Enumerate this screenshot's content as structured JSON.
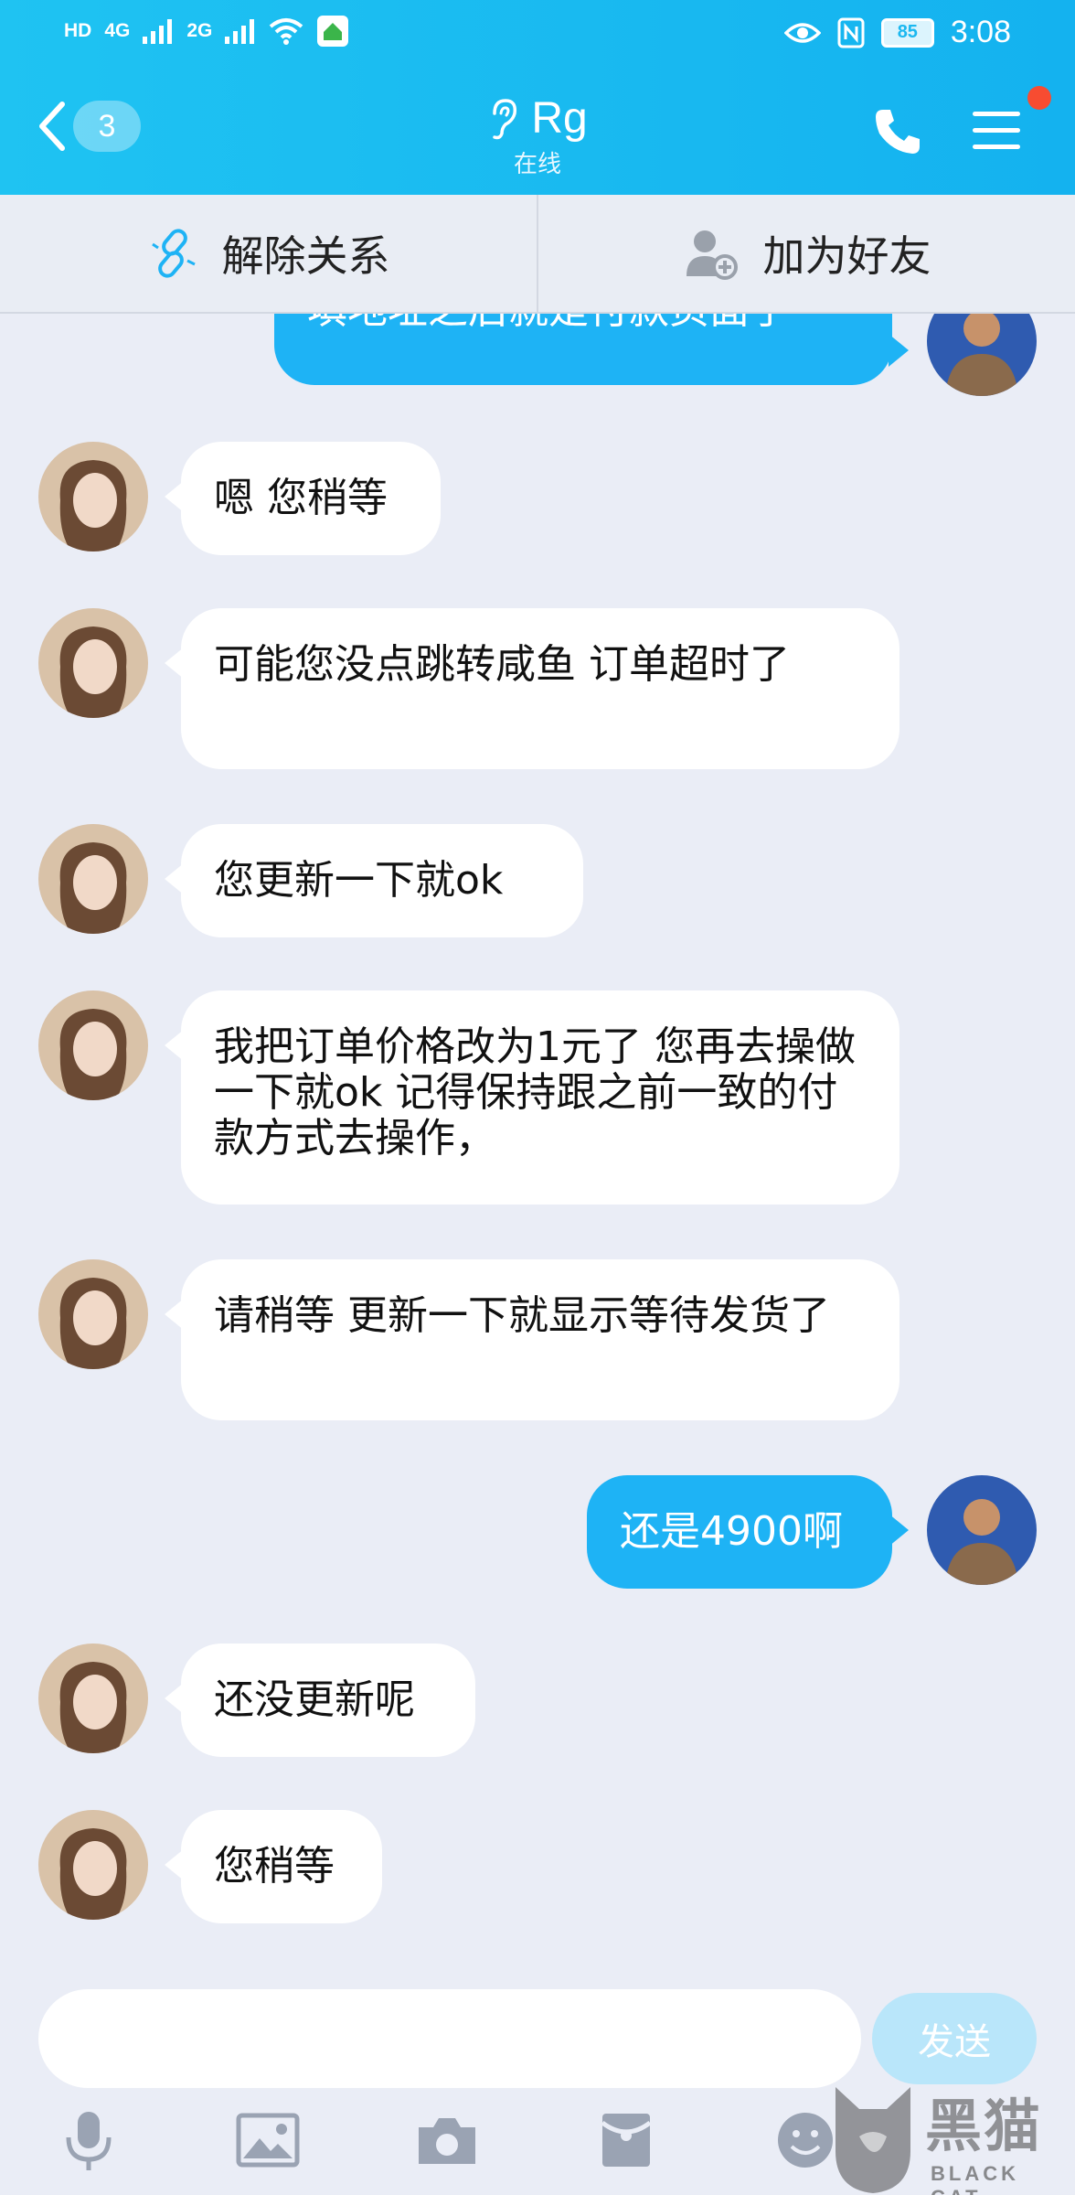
{
  "status_bar": {
    "network_left": "HD",
    "signal_1": "4G",
    "signal_2": "2G",
    "battery": "85",
    "time": "3:08"
  },
  "header": {
    "unread_count": "3",
    "contact_name": "Rg",
    "online_status": "在线",
    "icons": [
      "back-icon",
      "ear-icon",
      "phone-icon",
      "menu-icon"
    ],
    "accent_color": "#14b2ef",
    "notification_dot_color": "#f74c31"
  },
  "actions": {
    "unlink_label": "解除关系",
    "add_friend_label": "加为好友"
  },
  "messages": [
    {
      "side": "out",
      "text": "填地址之后就是付款页面了"
    },
    {
      "side": "in",
      "text": "嗯 您稍等"
    },
    {
      "side": "in",
      "text": "可能您没点跳转咸鱼  订单超时了"
    },
    {
      "side": "in",
      "text": " 您更新一下就ok"
    },
    {
      "side": "in",
      "text": "我把订单价格改为1元了 您再去操做一下就ok  记得保持跟之前一致的付款方式去操作，"
    },
    {
      "side": "in",
      "text": "请稍等 更新一下就显示等待发货了"
    },
    {
      "side": "out",
      "text": "还是4900啊"
    },
    {
      "side": "in",
      "text": "还没更新呢"
    },
    {
      "side": "in",
      "text": "您稍等"
    }
  ],
  "input": {
    "value": "",
    "placeholder": "",
    "send_label": "发送"
  },
  "toolbar": {
    "icons": [
      "microphone-icon",
      "image-icon",
      "camera-icon",
      "red-packet-icon",
      "emoji-icon"
    ]
  },
  "watermark": {
    "chars": "黑猫",
    "sub": "BLACK CAT"
  }
}
